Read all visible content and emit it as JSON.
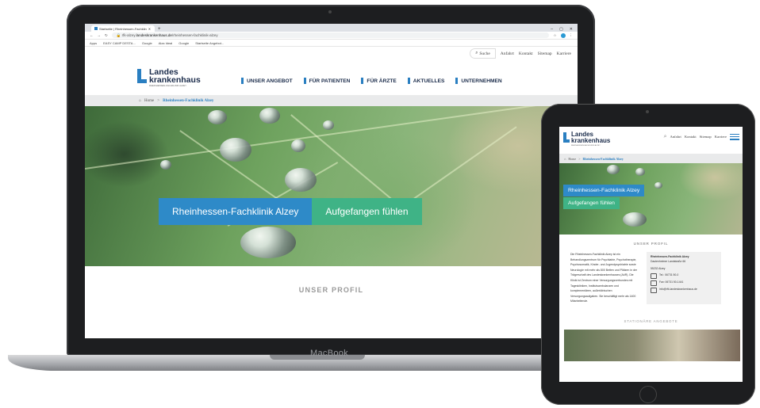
{
  "laptop": {
    "brand_label": "MacBook",
    "browser": {
      "tab_title": "Startseite | Rheinhessen-Fachklin",
      "url_host": "landeskrankenhaus.de",
      "url_prefix": "rfk-alzey.",
      "url_path": "/rheinhessen-fachklinik-alzey",
      "bookmarks": [
        "Apps",
        "EASY CAMP DESTA...",
        "Google",
        "Alza Ideal",
        "Google",
        "Startseite Angebot..."
      ]
    },
    "site": {
      "top_links": [
        "Suche",
        "Anfahrt",
        "Kontakt",
        "Sitemap",
        "Karriere"
      ],
      "logo": {
        "line1": "Landes",
        "line2": "krankenhaus",
        "sub": "RHEINHESSEN-FACHKLINIK ALZEY"
      },
      "main_nav": [
        "UNSER ANGEBOT",
        "FÜR PATIENTEN",
        "FÜR ÄRZTE",
        "AKTUELLES",
        "UNTERNEHMEN"
      ],
      "breadcrumb": {
        "home": "Home",
        "sep": ">",
        "current": "Rheinhessen-Fachklinik Alzey"
      },
      "hero_buttons": [
        "Rheinhessen-Fachklinik Alzey",
        "Aufgefangen fühlen"
      ],
      "section_title": "UNSER PROFIL"
    }
  },
  "tablet": {
    "logo": {
      "line1": "Landes",
      "line2": "krankenhaus",
      "sub": "RHEINHESSEN-FACHKLINIK ALZEY"
    },
    "top_links": [
      "Anfahrt",
      "Kontakt",
      "Sitemap",
      "Karriere"
    ],
    "breadcrumb": {
      "home": "Home",
      "sep": ">",
      "current": "Rheinhessen-Fachklinik Alzey"
    },
    "hero_buttons": [
      "Rheinhessen-Fachklinik Alzey",
      "Aufgefangen fühlen"
    ],
    "section_title": "UNSER PROFIL",
    "paragraph": "Die Rheinhessen-Fachklinik Alzey ist ein Behandlungszentrum für Psychiatrie, Psychotherapie, Psychosomatik, Kinder- und Jugendpsychiatrie sowie Neurologie mit mehr als 800 Betten und Plätzen in der Trägerschaft des Landeskrankenhauses (AöR). Die Klinik ist Zentrum einer Versorgungsverbundes mit Tageskliniken, Institutsambulanzen und komplementären, außerklinischen Versorgungsaufgaben. Sie beschäftigt mehr als 1400 Mitarbeitende.",
    "contact": {
      "name": "Rheinhessen-Fachklinik Alzey",
      "street": "Dautenheimer Landstraße 66",
      "city": "55232 Alzey",
      "phone": "Tel.: 06731 50-0",
      "fax": "Fax: 06731 50-1441",
      "email": "info@rfk.landeskrankenhaus.de"
    },
    "section2_title": "STATIONÄRE ANGEBOTE"
  }
}
